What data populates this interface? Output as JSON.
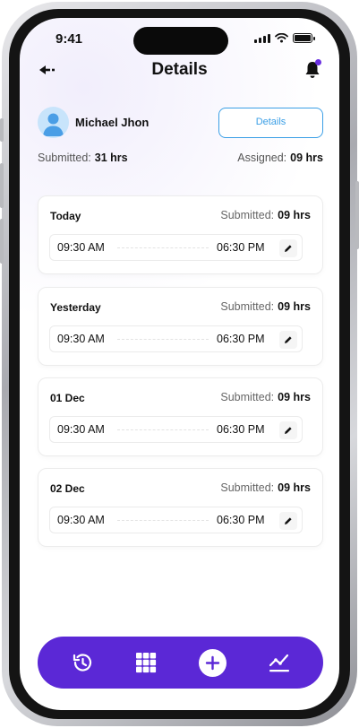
{
  "status": {
    "time": "9:41"
  },
  "header": {
    "title": "Details"
  },
  "user": {
    "name": "Michael Jhon",
    "details_label": "Details"
  },
  "summary": {
    "submitted_label": "Submitted:",
    "submitted_value": "31 hrs",
    "assigned_label": "Assigned:",
    "assigned_value": "09 hrs"
  },
  "entries": [
    {
      "label": "Today",
      "submitted_label": "Submitted:",
      "submitted_value": "09 hrs",
      "start": "09:30 AM",
      "end": "06:30 PM"
    },
    {
      "label": "Yesterday",
      "submitted_label": "Submitted:",
      "submitted_value": "09 hrs",
      "start": "09:30 AM",
      "end": "06:30 PM"
    },
    {
      "label": "01 Dec",
      "submitted_label": "Submitted:",
      "submitted_value": "09 hrs",
      "start": "09:30 AM",
      "end": "06:30 PM"
    },
    {
      "label": "02 Dec",
      "submitted_label": "Submitted:",
      "submitted_value": "09 hrs",
      "start": "09:30 AM",
      "end": "06:30 PM"
    }
  ],
  "nav": {
    "items": [
      "history-icon",
      "grid-icon",
      "add-icon",
      "analytics-icon"
    ]
  },
  "colors": {
    "accent": "#5b28d6",
    "link": "#3b9fe6",
    "notification_dot": "#6a2fe0"
  }
}
